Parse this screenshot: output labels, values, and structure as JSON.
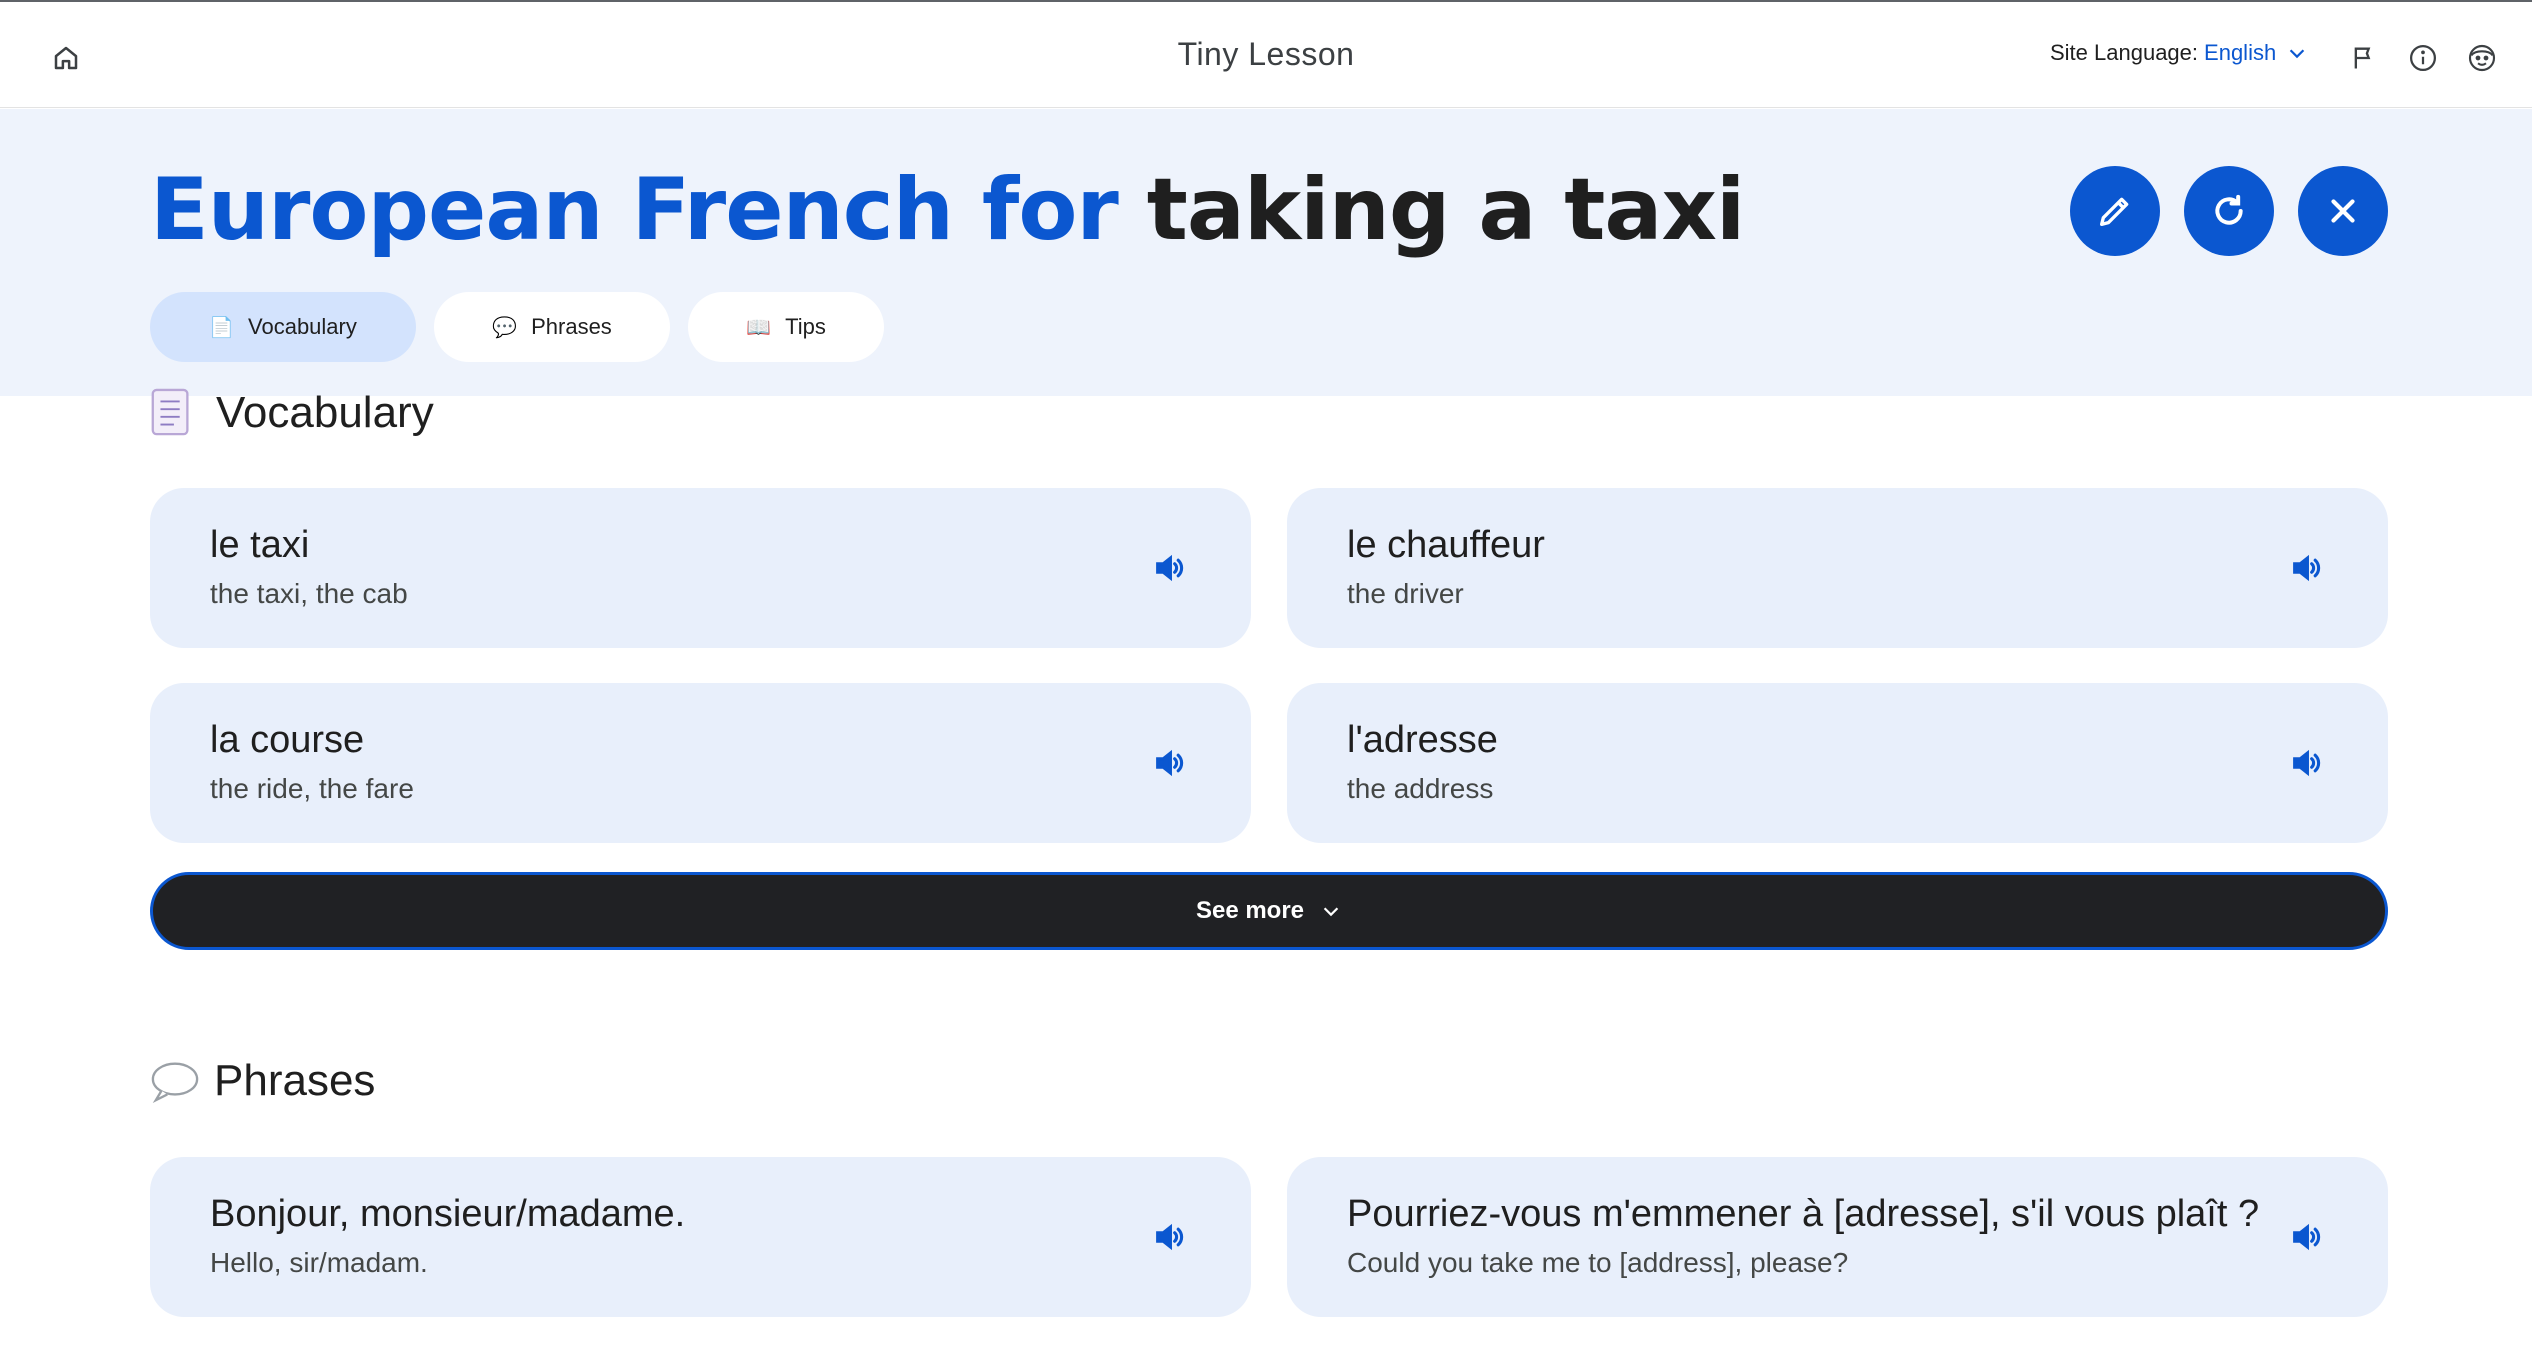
{
  "app": {
    "title": "Tiny Lesson",
    "site_language_label": "Site Language:",
    "site_language_value": "English"
  },
  "icons": {
    "home": "home-icon",
    "flag": "flag-icon",
    "info": "info-icon",
    "mascot": "mascot-icon",
    "edit": "pencil-icon",
    "refresh": "refresh-icon",
    "close": "close-icon",
    "speaker": "speaker-icon"
  },
  "colors": {
    "accent": "#0b57d0",
    "band": "#eef3fc",
    "card": "#e8effb",
    "active_tab": "#d3e3fd",
    "dark_button": "#202124"
  },
  "lesson": {
    "language": "European French for",
    "topic": "taking a taxi"
  },
  "tabs": [
    {
      "label": "Vocabulary",
      "icon": "📄",
      "active": true
    },
    {
      "label": "Phrases",
      "icon": "💬",
      "active": false
    },
    {
      "label": "Tips",
      "icon": "📖",
      "active": false
    }
  ],
  "vocabulary": {
    "heading": "Vocabulary",
    "items": [
      {
        "term": "le taxi",
        "meaning": "the taxi, the cab"
      },
      {
        "term": "le chauffeur",
        "meaning": "the driver"
      },
      {
        "term": "la course",
        "meaning": "the ride, the fare"
      },
      {
        "term": "l'adresse",
        "meaning": "the address"
      }
    ],
    "see_more": "See more"
  },
  "phrases": {
    "heading": "Phrases",
    "items": [
      {
        "term": "Bonjour, monsieur/madame.",
        "meaning": "Hello, sir/madam."
      },
      {
        "term": "Pourriez-vous m'emmener à [adresse], s'il vous plaît ?",
        "meaning": "Could you take me to [address], please?"
      }
    ]
  }
}
